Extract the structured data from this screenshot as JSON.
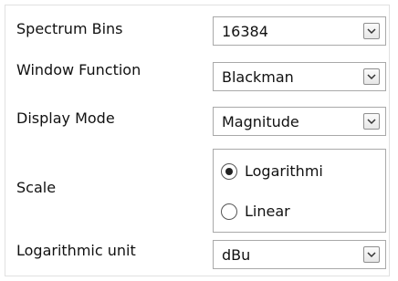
{
  "settings": {
    "rows": [
      {
        "label": "Spectrum Bins",
        "value": "16384",
        "icon": "chevron-down-icon"
      },
      {
        "label": "Window Function",
        "value": "Blackman",
        "icon": "chevron-down-icon"
      },
      {
        "label": "Display Mode",
        "value": "Magnitude",
        "icon": "chevron-down-icon"
      }
    ],
    "scale": {
      "label": "Scale",
      "options": [
        {
          "label": "Logarithmi",
          "selected": true
        },
        {
          "label": "Linear",
          "selected": false
        }
      ]
    },
    "logarithmic_unit": {
      "label": "Logarithmic unit",
      "value": "dBu",
      "icon": "chevron-down-icon"
    }
  },
  "colors": {
    "background": "#ffffff",
    "border": "#a9a9a9",
    "text": "#111111"
  }
}
